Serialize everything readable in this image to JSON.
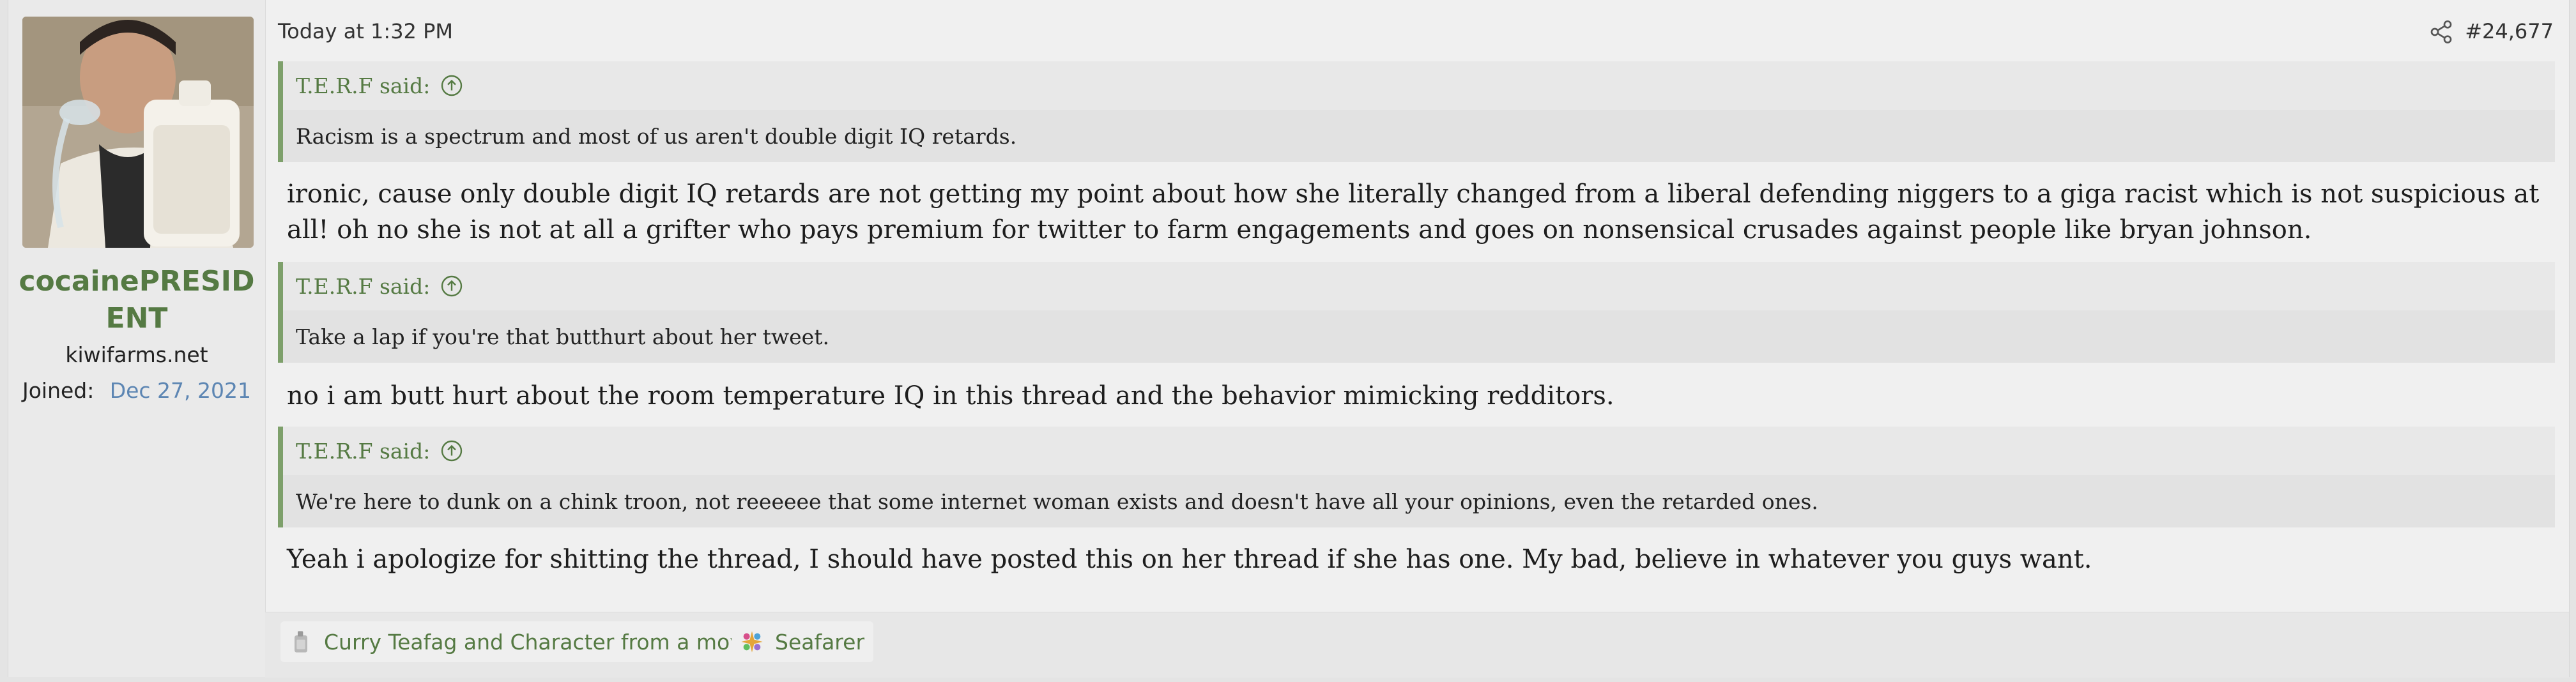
{
  "user": {
    "username": "cocainePRESIDENT",
    "site": "kiwifarms.net",
    "joined_label": "Joined:",
    "joined_value": "Dec 27, 2021"
  },
  "post": {
    "timestamp": "Today at 1:32 PM",
    "number": "#24,677",
    "quotes": [
      {
        "author": "T.E.R.F said:",
        "text": "Racism is a spectrum and most of us aren't double digit IQ retards."
      },
      {
        "author": "T.E.R.F said:",
        "text": "Take a lap if you're that butthurt about her tweet."
      },
      {
        "author": "T.E.R.F said:",
        "text": "We're here to dunk on a chink troon, not reeeeee that some internet woman exists and doesn't have all your opinions, even the retarded ones."
      }
    ],
    "messages": [
      "ironic, cause only double digit IQ retards are not getting my point about how she literally changed from a liberal defending niggers to a giga racist which is not suspicious at all! oh no she is not at all a grifter who pays premium for twitter to farm engagements and goes on nonsensical crusades against people like bryan johnson.",
      "no i am butt hurt about the room temperature IQ in this thread and the behavior mimicking redditors.",
      "Yeah i apologize for shitting the thread, I should have posted this on her thread if she has one. My bad, believe in whatever you guys want."
    ]
  },
  "footer": {
    "reactions": [
      {
        "label": "Curry Teafag and Character from a movie",
        "icon": "jug-icon"
      },
      {
        "label": "Seafarer",
        "icon": "seafarer-star-icon"
      }
    ]
  },
  "colors": {
    "accent_green": "#557a43",
    "quote_border": "#7ea06b",
    "link_blue": "#5d86b3"
  }
}
